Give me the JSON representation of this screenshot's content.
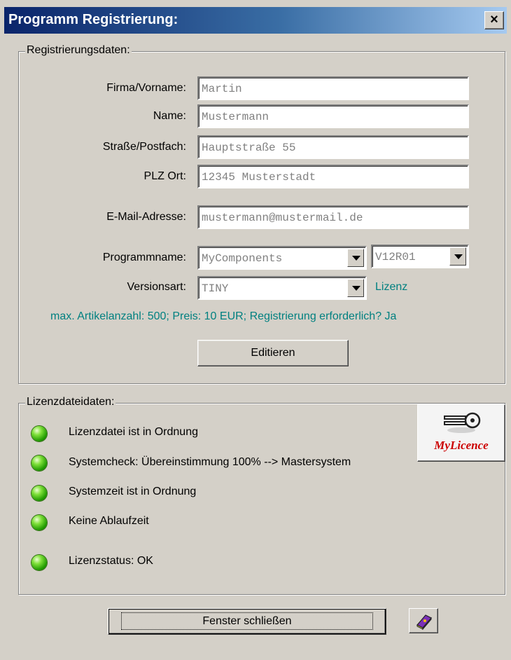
{
  "window": {
    "title": "Programm Registrierung:",
    "close_glyph": "×"
  },
  "registration": {
    "legend": "Registrierungsdaten:",
    "fields": {
      "firma": {
        "label": "Firma/Vorname:",
        "value": "Martin"
      },
      "name": {
        "label": "Name:",
        "value": "Mustermann"
      },
      "strasse": {
        "label": "Straße/Postfach:",
        "value": "Hauptstraße 55"
      },
      "plz": {
        "label": "PLZ Ort:",
        "value": "12345 Musterstadt"
      },
      "email": {
        "label": "E-Mail-Adresse:",
        "value": "mustermann@mustermail.de"
      }
    },
    "programmname": {
      "label": "Programmname:",
      "value": "MyComponents",
      "version": "V12R01"
    },
    "versionsart": {
      "label": "Versionsart:",
      "value": "TINY",
      "link": "Lizenz"
    },
    "info": "max. Artikelanzahl: 500;  Preis: 10 EUR;  Registrierung erforderlich? Ja",
    "edit_button": "Editieren"
  },
  "license": {
    "legend": "Lizenzdateidaten:",
    "statuses": [
      "Lizenzdatei ist in Ordnung",
      "Systemcheck: Übereinstimmung 100% --> Mastersystem",
      "Systemzeit ist in Ordnung",
      "Keine Ablaufzeit",
      "Lizenzstatus: OK"
    ],
    "logo_text": "MyLicence",
    "status_color": "#1f9a00"
  },
  "footer": {
    "close_button": "Fenster schließen"
  },
  "icons": {
    "close": "close-icon",
    "key": "key-icon",
    "help": "help-book-icon",
    "dropdown": "chevron-down-icon",
    "status": "status-led-icon"
  },
  "colors": {
    "titlebar_start": "#0a246a",
    "titlebar_end": "#a6caf0",
    "info_text": "#008080",
    "logo_text": "#cc0000"
  }
}
